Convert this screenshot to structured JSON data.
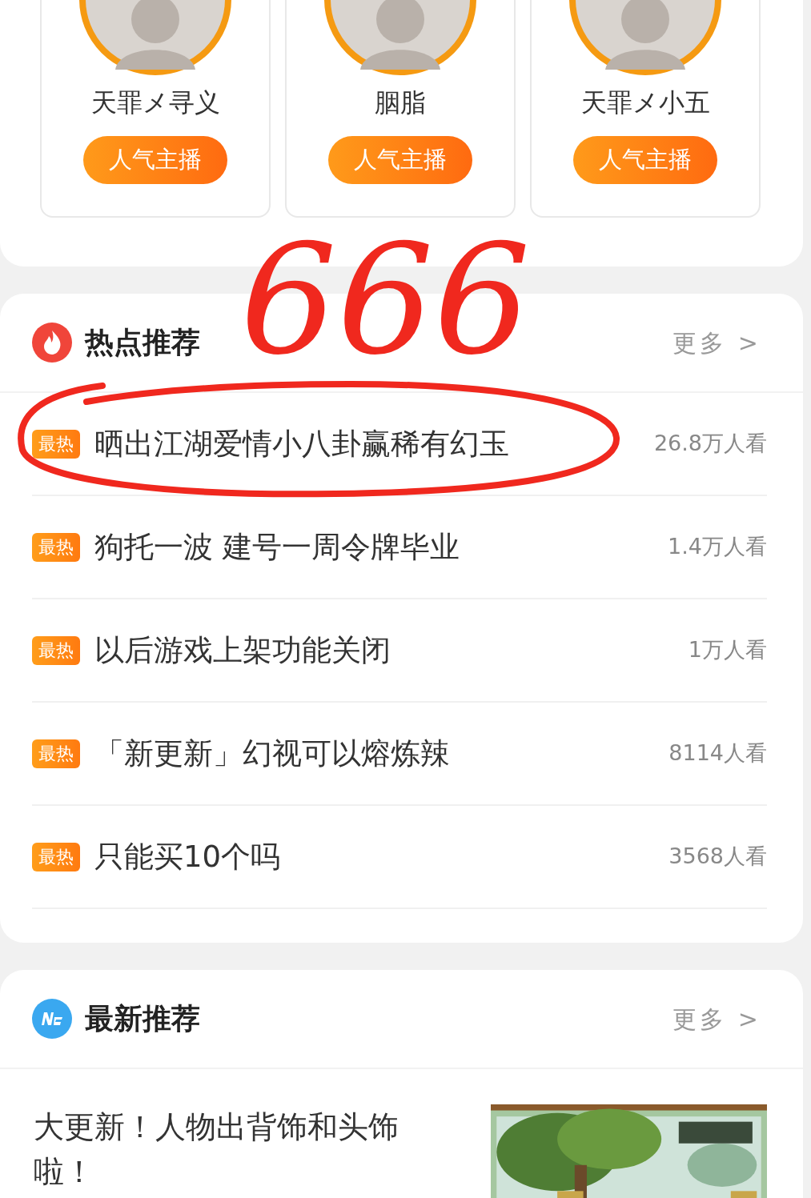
{
  "streamers": [
    {
      "name": "天罪メ寻义",
      "badge": "人气主播"
    },
    {
      "name": "胭脂",
      "badge": "人气主播"
    },
    {
      "name": "天罪メ小五",
      "badge": "人气主播"
    }
  ],
  "hot": {
    "title": "热点推荐",
    "more": "更多 >",
    "items": [
      {
        "badge": "最热",
        "title": "晒出江湖爱情小八卦赢稀有幻玉",
        "views": "26.8万人看"
      },
      {
        "badge": "最热",
        "title": "狗托一波 建号一周令牌毕业",
        "views": "1.4万人看"
      },
      {
        "badge": "最热",
        "title": "以后游戏上架功能关闭",
        "views": "1万人看"
      },
      {
        "badge": "最热",
        "title": "「新更新」幻视可以熔炼辣",
        "views": "8114人看"
      },
      {
        "badge": "最热",
        "title": "只能买10个吗",
        "views": "3568人看"
      }
    ]
  },
  "latest": {
    "title": "最新推荐",
    "more": "更多 >",
    "articles": [
      {
        "title": "大更新！人物出背饰和头饰啦！",
        "kind": "picture"
      }
    ]
  },
  "annotation": {
    "text": "666"
  }
}
